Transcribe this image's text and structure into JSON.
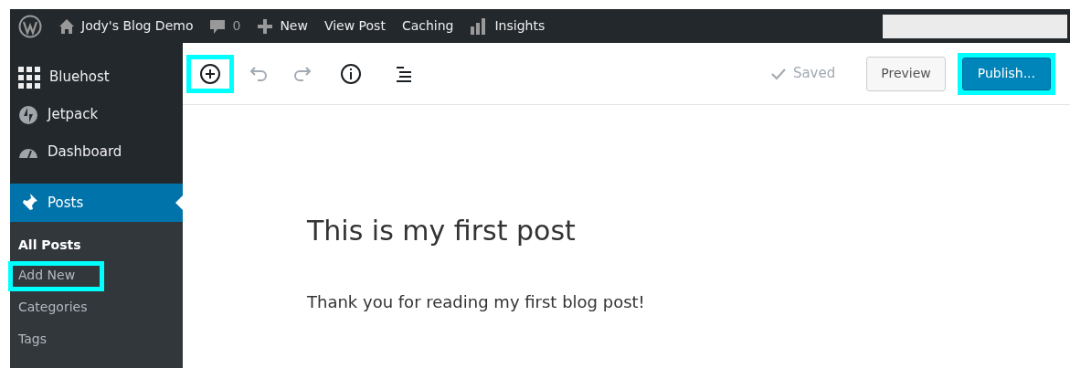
{
  "admin_bar": {
    "items": [
      {
        "kind": "logo"
      },
      {
        "kind": "home",
        "label": "Jody's Blog Demo"
      },
      {
        "kind": "comments",
        "label": "0"
      },
      {
        "kind": "plus",
        "label": "New"
      },
      {
        "kind": "text",
        "label": "View Post"
      },
      {
        "kind": "text",
        "label": "Caching"
      },
      {
        "kind": "chart",
        "label": "Insights"
      }
    ]
  },
  "sidebar": {
    "items": [
      {
        "kind": "grid",
        "label": "Bluehost",
        "selected": false
      },
      {
        "kind": "bolt",
        "label": "Jetpack",
        "selected": false
      },
      {
        "kind": "gauge",
        "label": "Dashboard",
        "selected": false
      },
      {
        "kind": "pin",
        "label": "Posts",
        "selected": true
      }
    ],
    "submenu": [
      {
        "label": "All Posts",
        "selected": true,
        "highlighted": false
      },
      {
        "label": "Add New",
        "selected": false,
        "highlighted": true
      },
      {
        "label": "Categories",
        "selected": false,
        "highlighted": false
      },
      {
        "label": "Tags",
        "selected": false,
        "highlighted": false
      }
    ]
  },
  "toolbar": {
    "tools": [
      {
        "kind": "add",
        "disabled": false,
        "highlighted": true
      },
      {
        "kind": "undo",
        "disabled": true,
        "highlighted": false
      },
      {
        "kind": "redo",
        "disabled": true,
        "highlighted": false
      },
      {
        "kind": "info",
        "disabled": false,
        "highlighted": false
      },
      {
        "kind": "outline",
        "disabled": false,
        "highlighted": false
      }
    ],
    "status": "Saved",
    "preview": "Preview",
    "publish": {
      "label": "Publish...",
      "highlighted": true
    }
  },
  "post": {
    "title": "This is my first post",
    "body": "Thank you for reading my first blog post!"
  }
}
